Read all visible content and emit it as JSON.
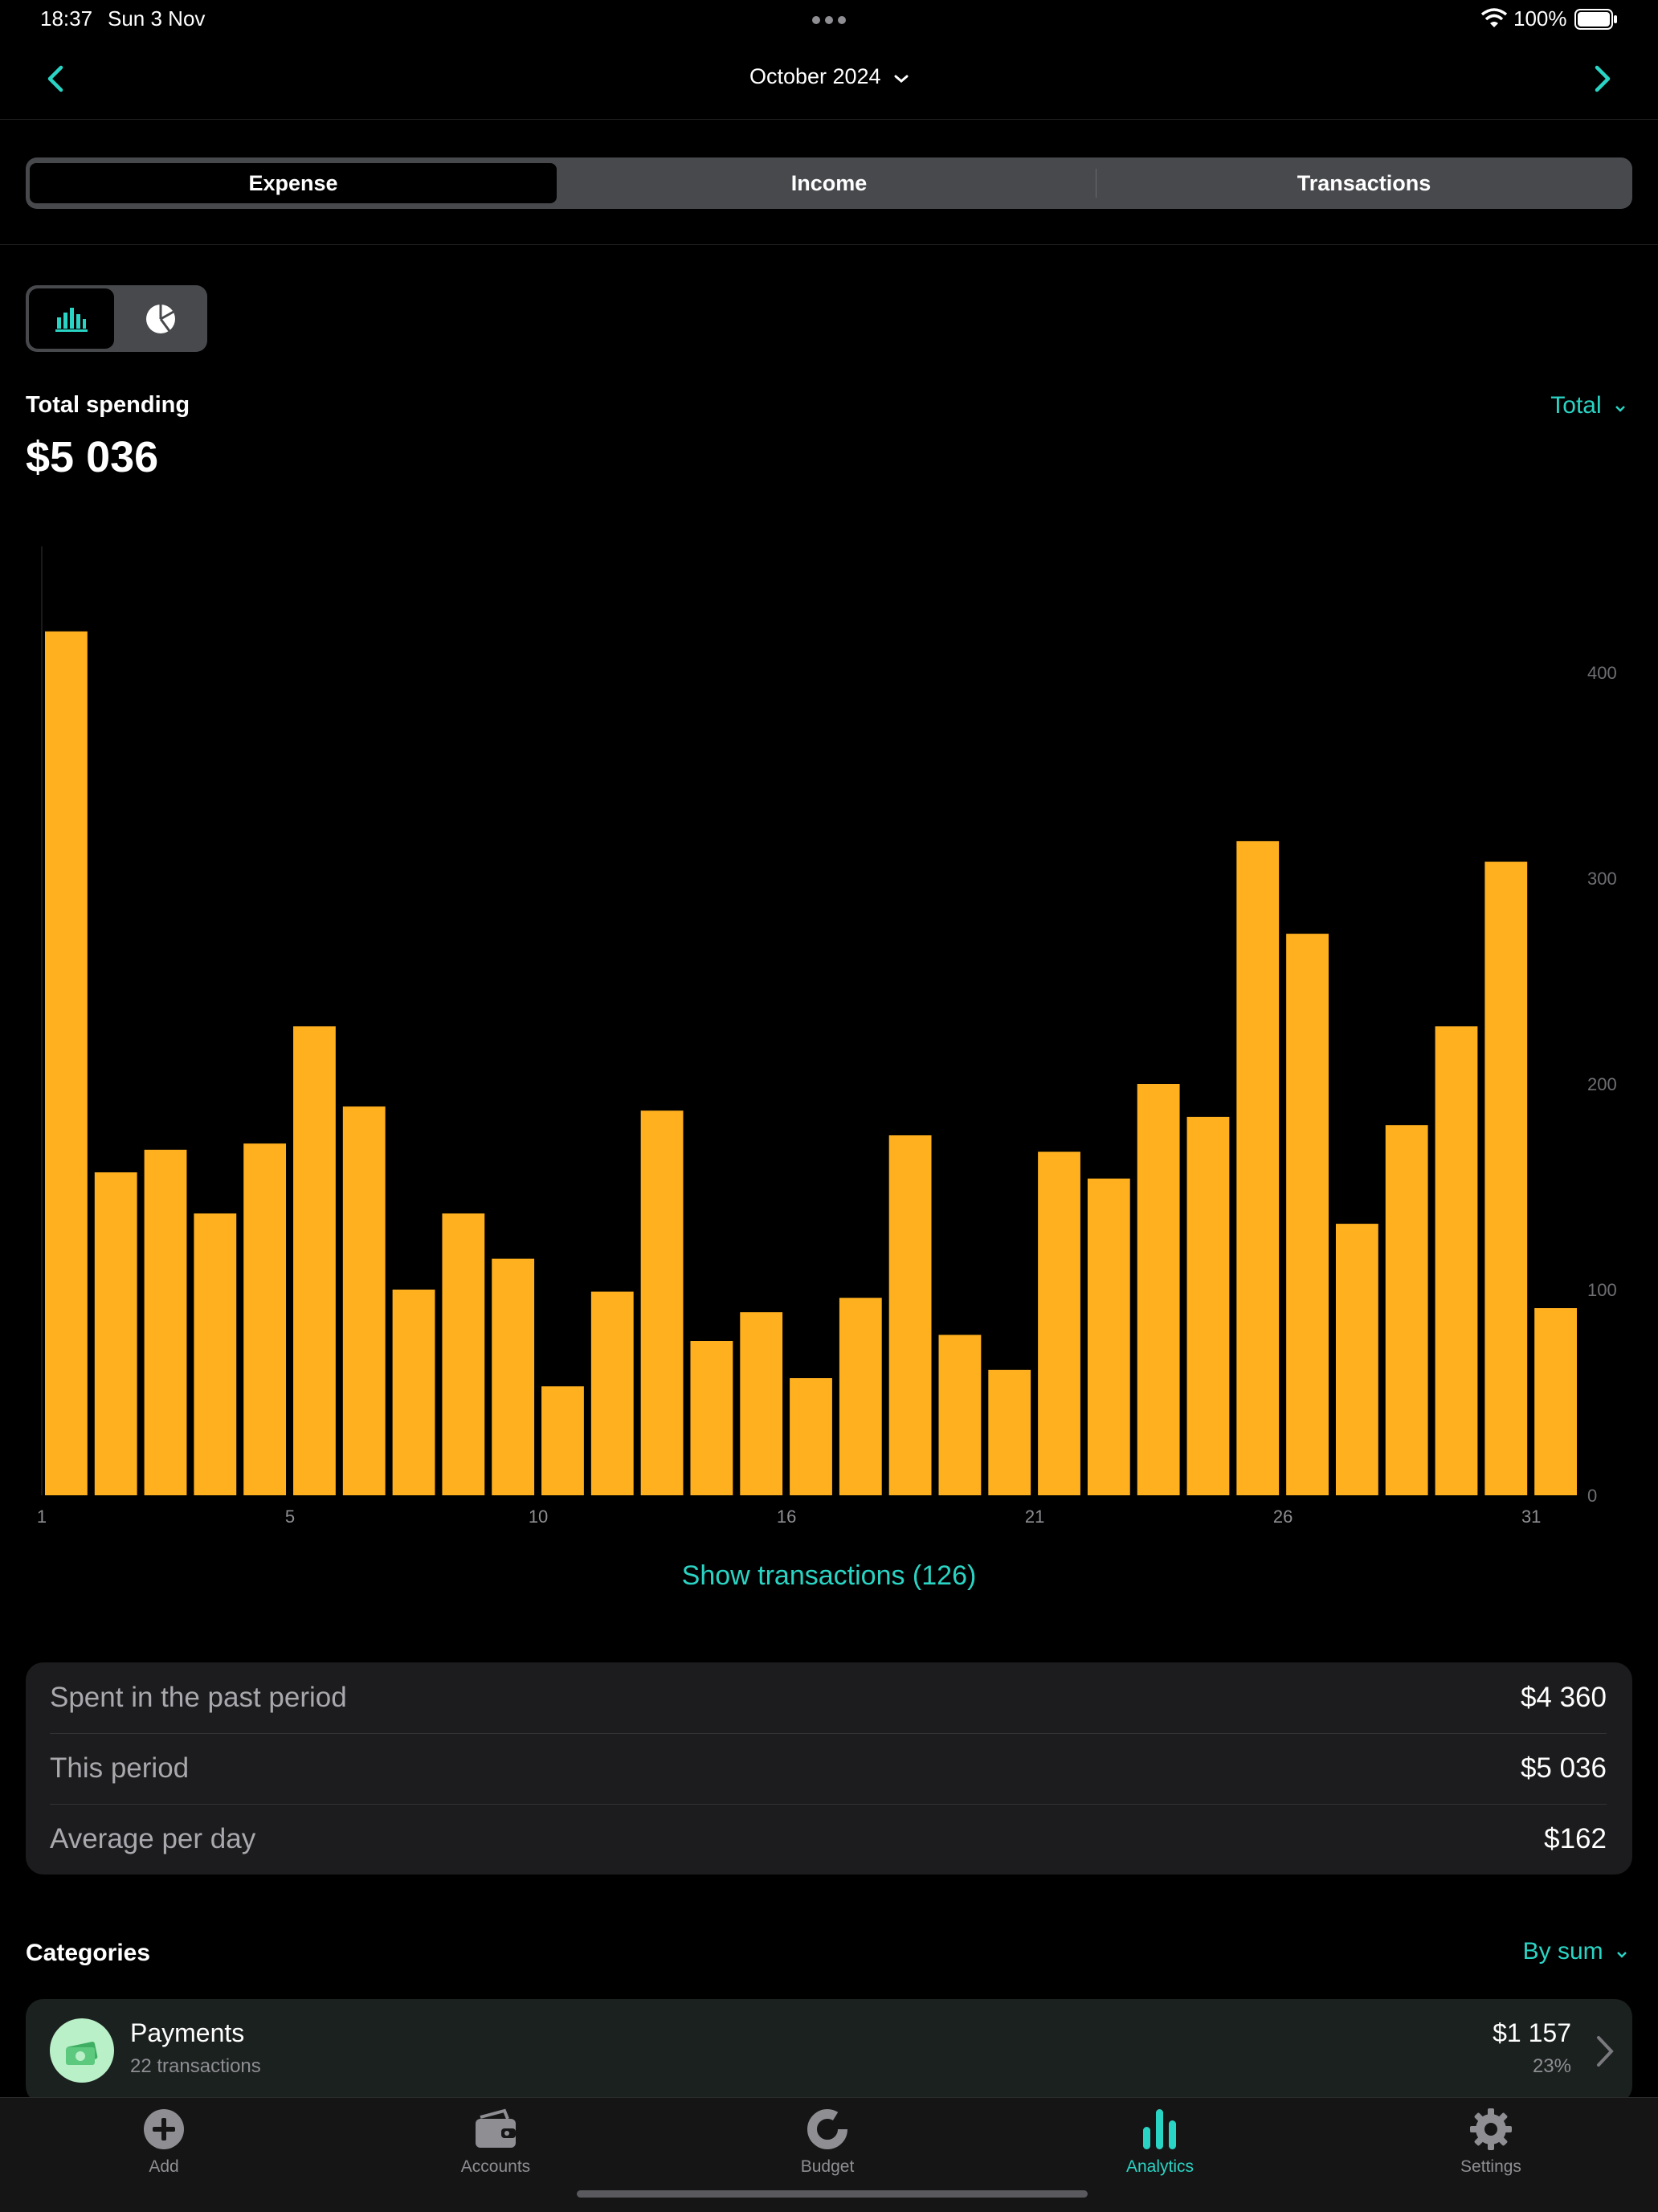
{
  "status_bar": {
    "time": "18:37",
    "date": "Sun 3 Nov",
    "battery": "100%"
  },
  "header": {
    "title": "October 2024"
  },
  "segments": [
    "Expense",
    "Income",
    "Transactions"
  ],
  "summary": {
    "label": "Total spending",
    "amount": "$5 036",
    "filter": "Total"
  },
  "chart_data": {
    "type": "bar",
    "x": [
      1,
      2,
      3,
      4,
      5,
      6,
      7,
      8,
      9,
      10,
      11,
      12,
      13,
      14,
      15,
      16,
      17,
      18,
      19,
      20,
      21,
      22,
      23,
      24,
      25,
      26,
      27,
      28,
      29,
      30,
      31
    ],
    "values": [
      420,
      157,
      168,
      137,
      171,
      228,
      189,
      100,
      137,
      115,
      53,
      99,
      187,
      75,
      89,
      57,
      96,
      175,
      78,
      61,
      167,
      154,
      200,
      184,
      318,
      273,
      132,
      180,
      228,
      308,
      91
    ],
    "xticks": [
      "1",
      "5",
      "10",
      "16",
      "21",
      "26",
      "31"
    ],
    "xtick_days": [
      1,
      6,
      11,
      16,
      21,
      26,
      31
    ],
    "yticks": [
      "0",
      "100",
      "200",
      "300",
      "400"
    ],
    "ylim": [
      0,
      420
    ],
    "color": "#ffb01f"
  },
  "show_transactions": "Show transactions (126)",
  "stats": [
    {
      "label": "Spent in the past period",
      "value": "$4 360"
    },
    {
      "label": "This period",
      "value": "$5 036"
    },
    {
      "label": "Average per day",
      "value": "$162"
    }
  ],
  "categories": {
    "title": "Categories",
    "sort": "By sum",
    "items": [
      {
        "name": "Payments",
        "count": "22 transactions",
        "amount": "$1 157",
        "percent": "23%"
      }
    ]
  },
  "tabs": [
    "Add",
    "Accounts",
    "Budget",
    "Analytics",
    "Settings"
  ],
  "colors": {
    "accent": "#2ad4c4",
    "bar": "#ffb01f",
    "background": "#000000"
  }
}
